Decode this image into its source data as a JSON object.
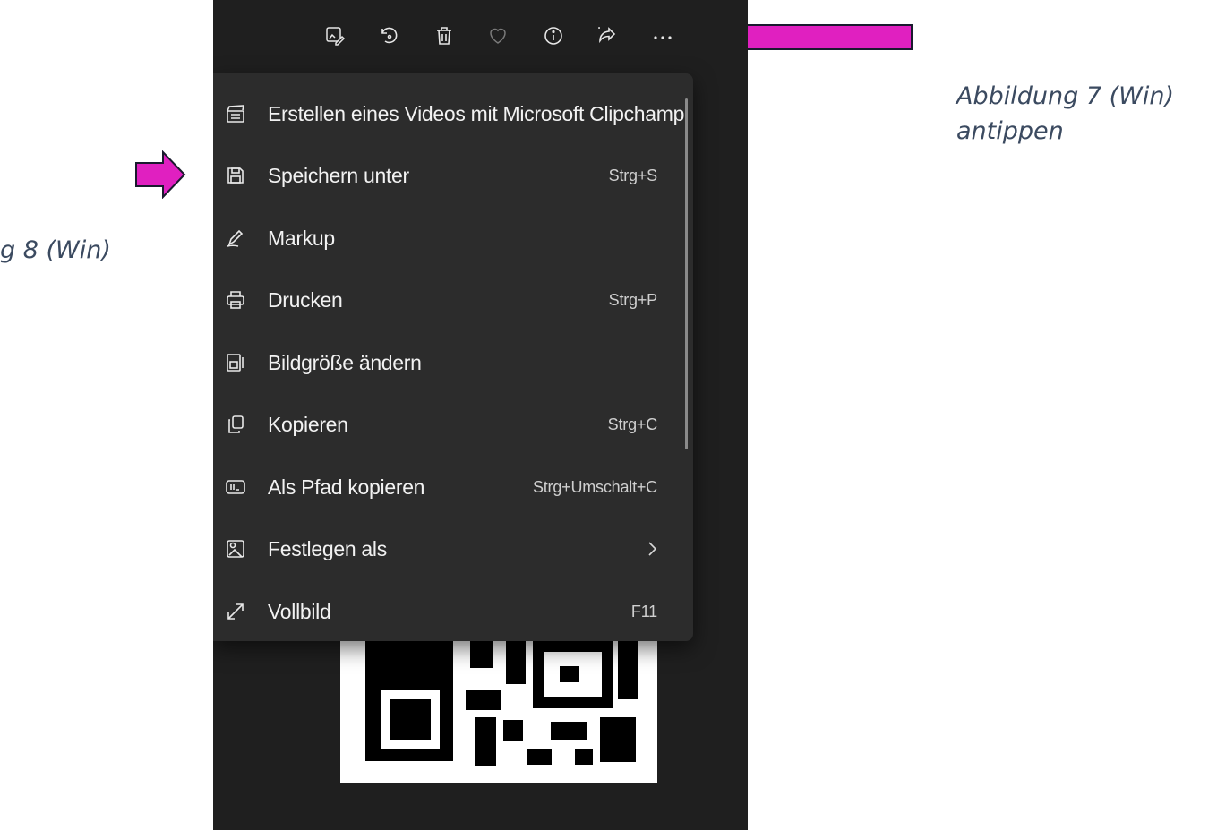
{
  "captions": {
    "right": [
      "Abbildung 7 (Win)",
      "antippen"
    ],
    "left": "g 8 (Win)"
  },
  "colors": {
    "arrow": "#e020c0",
    "arrow_border": "#1a1a2e",
    "caption": "#3b4a60",
    "menu_bg": "#2c2c2c",
    "app_bg": "#1f1f1f"
  },
  "toolbar": {
    "buttons": [
      {
        "icon": "edit-image-icon"
      },
      {
        "icon": "rotate-icon"
      },
      {
        "icon": "delete-icon"
      },
      {
        "icon": "favorite-icon"
      },
      {
        "icon": "info-icon"
      },
      {
        "icon": "share-icon"
      },
      {
        "icon": "more-icon"
      }
    ]
  },
  "menu": {
    "items": [
      {
        "icon": "clipchamp-icon",
        "label": "Erstellen eines Videos mit Microsoft Clipchamp",
        "shortcut": ""
      },
      {
        "icon": "save-icon",
        "label": "Speichern unter",
        "shortcut": "Strg+S"
      },
      {
        "icon": "markup-icon",
        "label": "Markup",
        "shortcut": ""
      },
      {
        "icon": "print-icon",
        "label": "Drucken",
        "shortcut": "Strg+P"
      },
      {
        "icon": "resize-icon",
        "label": "Bildgröße ändern",
        "shortcut": ""
      },
      {
        "icon": "copy-icon",
        "label": "Kopieren",
        "shortcut": "Strg+C"
      },
      {
        "icon": "copy-path-icon",
        "label": "Als Pfad kopieren",
        "shortcut": "Strg+Umschalt+C"
      },
      {
        "icon": "set-as-icon",
        "label": "Festlegen als",
        "shortcut": "",
        "submenu": true
      },
      {
        "icon": "fullscreen-icon",
        "label": "Vollbild",
        "shortcut": "F11"
      }
    ]
  }
}
